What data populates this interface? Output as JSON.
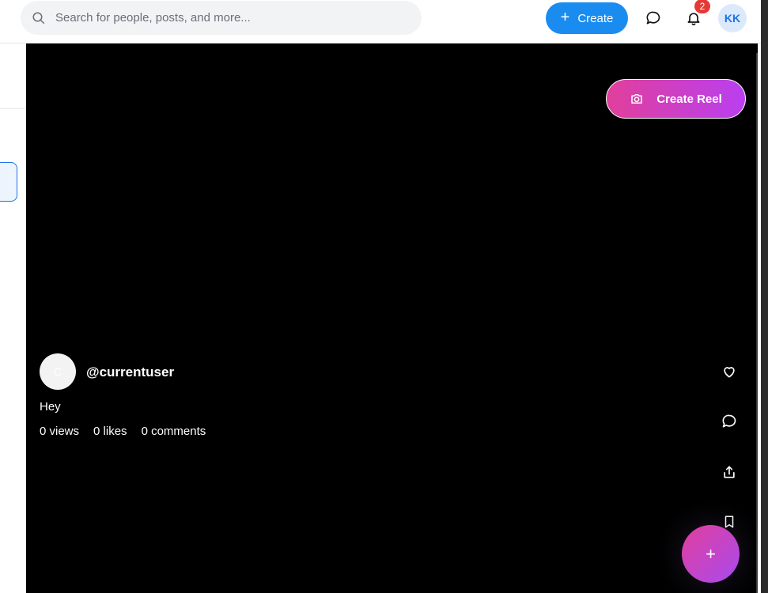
{
  "search": {
    "placeholder": "Search for people, posts, and more..."
  },
  "header": {
    "create_label": "Create",
    "notification_count": "2",
    "avatar_initials": "KK"
  },
  "reel": {
    "create_reel_label": "Create Reel",
    "author_initial": "C",
    "author_handle": "@currentuser",
    "caption": "Hey",
    "stats": {
      "views": "0 views",
      "likes": "0 likes",
      "comments": "0 comments"
    },
    "fab_label": "+"
  },
  "colors": {
    "brand_blue": "#1a8cf0",
    "reel_gradient_start": "#e13f9b",
    "reel_gradient_end": "#b93ff0",
    "badge_red": "#e53935"
  },
  "icons": [
    "search-icon",
    "plus-icon",
    "message-icon",
    "bell-icon",
    "camera-icon",
    "heart-icon",
    "comment-icon",
    "share-icon",
    "bookmark-icon"
  ]
}
